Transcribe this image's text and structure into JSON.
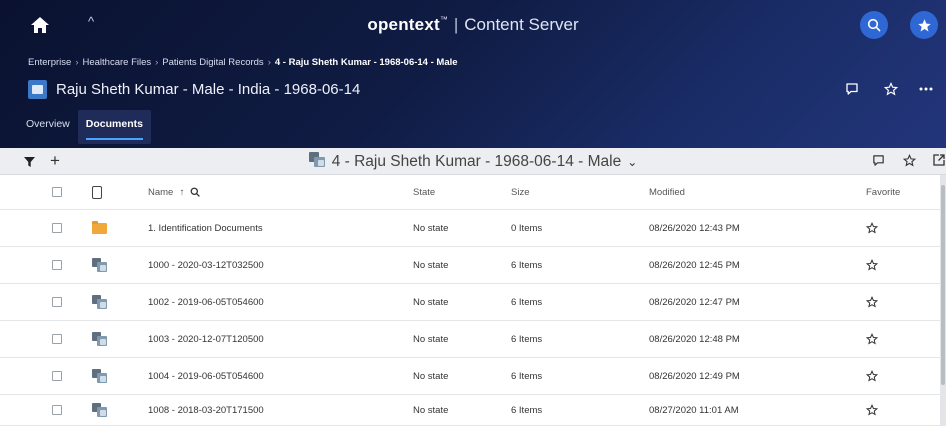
{
  "app": {
    "brand_bold": "opentext",
    "brand_tm": "™",
    "brand_sep": "|",
    "brand_rest": "Content Server"
  },
  "icons": {
    "home": "home-icon",
    "caret_up": "^",
    "search": "search-icon",
    "favorites": "star-icon"
  },
  "breadcrumb": {
    "items": [
      "Enterprise",
      "Healthcare Files",
      "Patients Digital Records"
    ],
    "separator": "›",
    "current": "4 - Raju Sheth Kumar - 1968-06-14 - Male"
  },
  "page": {
    "title": "Raju Sheth Kumar - Male - India - 1968-06-14"
  },
  "tabs": [
    {
      "label": "Overview",
      "active": false
    },
    {
      "label": "Documents",
      "active": true
    }
  ],
  "toolbar": {
    "container_title": "4 - Raju Sheth Kumar - 1968-06-14 - Male",
    "chevron": "⌄",
    "add": "+"
  },
  "table": {
    "headers": {
      "name": "Name",
      "sort_arrow": "↑",
      "state": "State",
      "size": "Size",
      "modified": "Modified",
      "favorite": "Favorite"
    },
    "rows": [
      {
        "type": "folder",
        "name": "1. Identification Documents",
        "state": "No state",
        "size": "0 Items",
        "modified": "08/26/2020 12:43 PM"
      },
      {
        "type": "compound",
        "name": "1000 - 2020-03-12T032500",
        "state": "No state",
        "size": "6 Items",
        "modified": "08/26/2020 12:45 PM"
      },
      {
        "type": "compound",
        "name": "1002 - 2019-06-05T054600",
        "state": "No state",
        "size": "6 Items",
        "modified": "08/26/2020 12:47 PM"
      },
      {
        "type": "compound",
        "name": "1003 - 2020-12-07T120500",
        "state": "No state",
        "size": "6 Items",
        "modified": "08/26/2020 12:48 PM"
      },
      {
        "type": "compound",
        "name": "1004 - 2019-06-05T054600",
        "state": "No state",
        "size": "6 Items",
        "modified": "08/26/2020 12:49 PM"
      },
      {
        "type": "compound",
        "name": "1008 - 2018-03-20T171500",
        "state": "No state",
        "size": "6 Items",
        "modified": "08/27/2020 11:01 AM"
      }
    ]
  },
  "colors": {
    "header_dark": "#0a1230",
    "header_light": "#23357a",
    "accent_blue": "#2f67d4",
    "folder": "#f0a83a",
    "toolbar_bg": "#eceef1"
  }
}
